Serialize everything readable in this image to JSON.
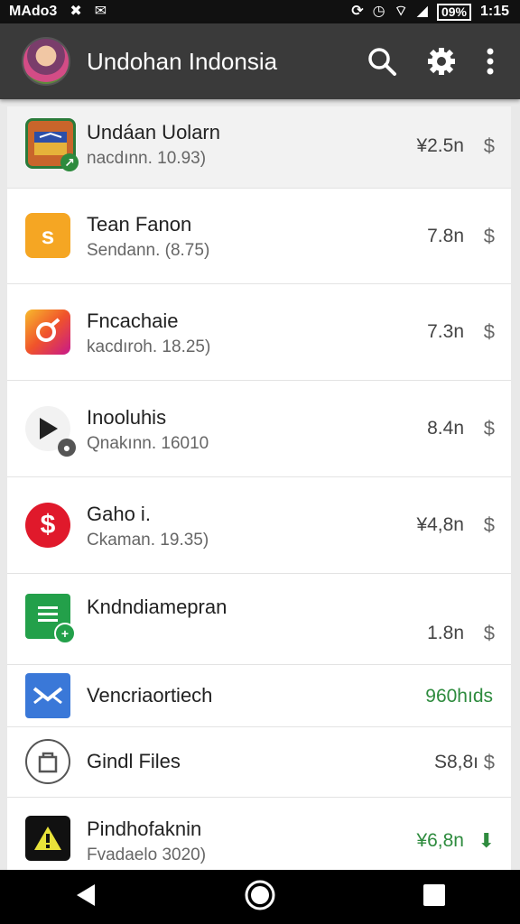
{
  "status_bar": {
    "carrier": "MAdo3",
    "battery": "09%",
    "time": "1:15"
  },
  "app_bar": {
    "title": "Undohan Indonsia"
  },
  "apps": [
    {
      "title": "Undáan Uolarn",
      "subtitle": "nacdınn. 10.93)",
      "size": "¥2.5n",
      "icon": "game-app-icon",
      "action_icon": "dollar-icon"
    },
    {
      "title": "Tean Fanon",
      "subtitle": "Sendann. (8.75)",
      "size": "7.8n",
      "icon": "sticker-app-icon",
      "action_icon": "dollar-icon"
    },
    {
      "title": "Fncachaie",
      "subtitle": "kacdıroh. 18.25)",
      "size": "7.3n",
      "icon": "camera-app-icon",
      "action_icon": "dollar-icon"
    },
    {
      "title": "Inooluhis",
      "subtitle": "Qnakınn. 16010",
      "size": "8.4n",
      "icon": "video-player-app-icon",
      "action_icon": "dollar-icon"
    },
    {
      "title": "Gaho i.",
      "subtitle": "Ckaman. 19.35)",
      "size": "¥4,8n",
      "icon": "dollar-app-icon",
      "action_icon": "dollar-icon"
    },
    {
      "title": "Kndndiamepran",
      "subtitle": "",
      "size": "1.8n",
      "icon": "sheets-app-icon",
      "action_icon": "dollar-icon"
    },
    {
      "title": "Vencriaortiech",
      "subtitle": "",
      "size": "960hıds",
      "icon": "mail-app-icon",
      "action_icon": ""
    },
    {
      "title": "Gindl Files",
      "subtitle": "",
      "size": "S8,8ı",
      "icon": "files-app-icon",
      "action_icon": "dollar-icon"
    },
    {
      "title": "Pindhofaknin",
      "subtitle": "Fvadaelo 3020)",
      "size": "¥6,8n",
      "icon": "warning-app-icon",
      "action_icon": "download-arrow-icon"
    }
  ],
  "colors": {
    "app_bar": "#3a3a3a",
    "accent_green": "#2e8b3e"
  }
}
